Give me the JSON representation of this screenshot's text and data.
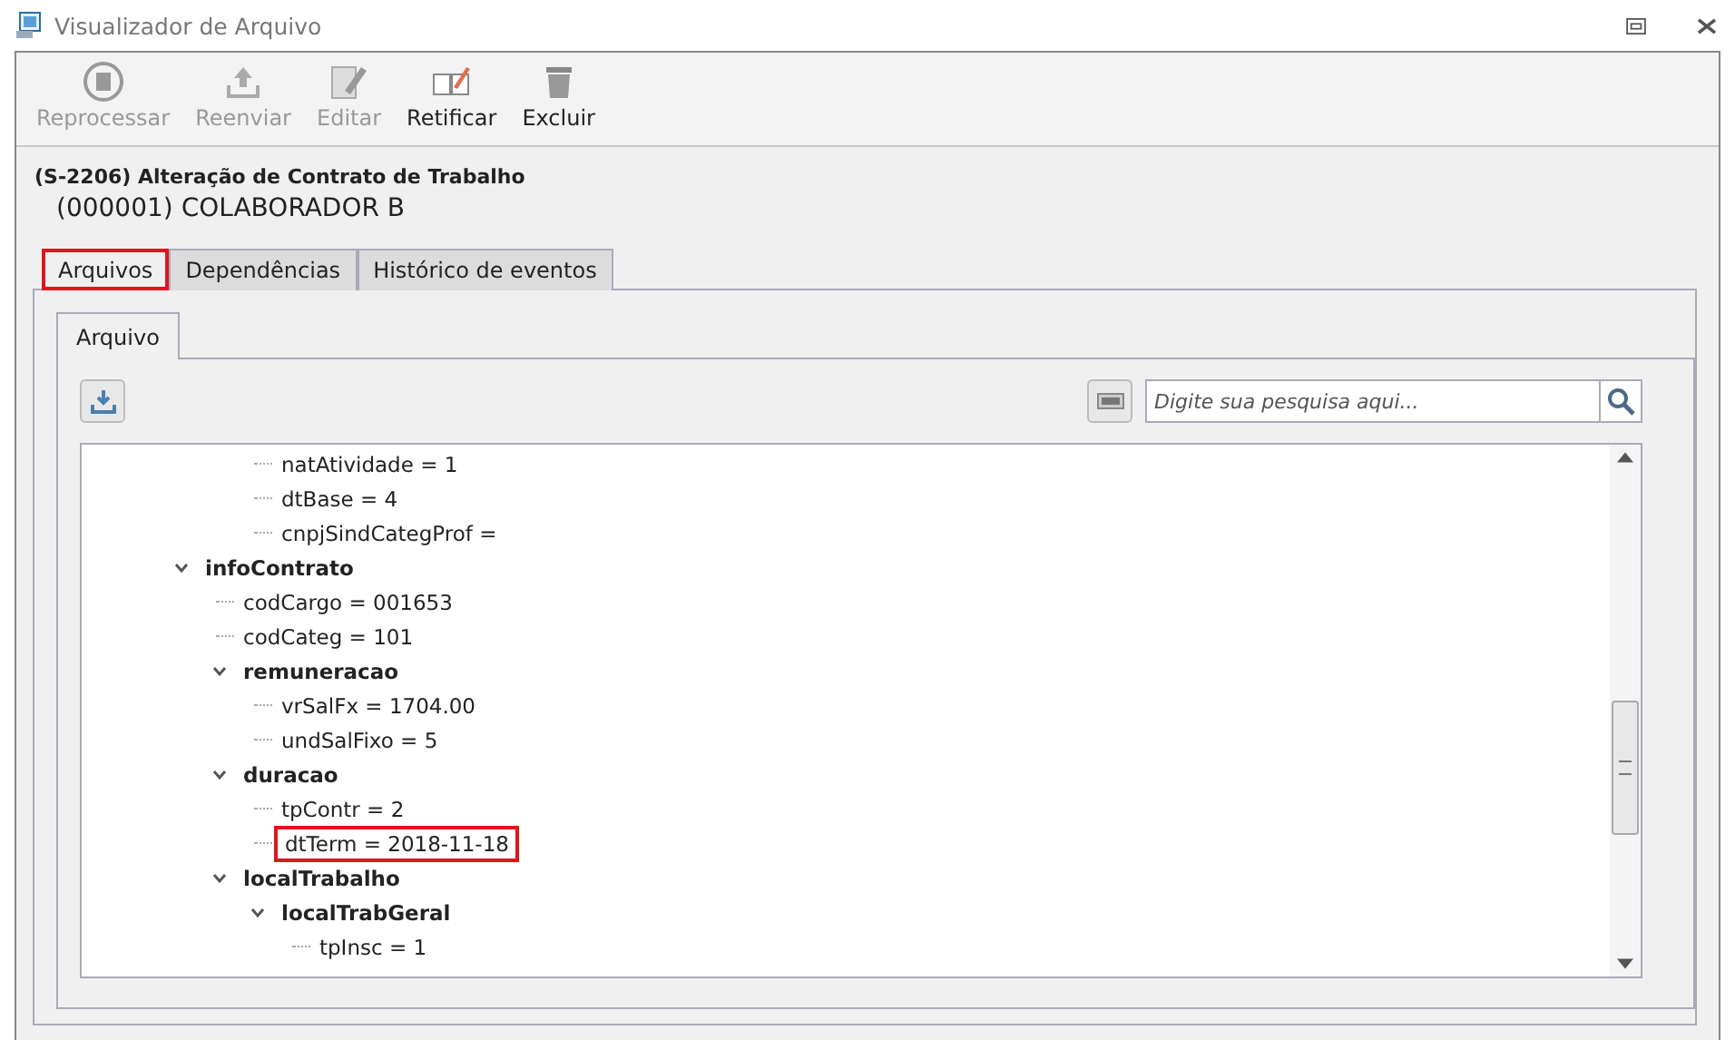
{
  "window": {
    "title": "Visualizador de Arquivo"
  },
  "toolbar": [
    {
      "label": "Reprocessar",
      "kind": "reprocess",
      "disabled": true
    },
    {
      "label": "Reenviar",
      "kind": "upload",
      "disabled": true
    },
    {
      "label": "Editar",
      "kind": "edit",
      "disabled": true
    },
    {
      "label": "Retificar",
      "kind": "rectify",
      "disabled": false
    },
    {
      "label": "Excluir",
      "kind": "delete",
      "disabled": false
    }
  ],
  "header": {
    "event": "(S-2206) Alteração de Contrato de Trabalho",
    "employee": "(000001) COLABORADOR B"
  },
  "tabs": [
    {
      "label": "Arquivos",
      "selected": true,
      "highlighted": true
    },
    {
      "label": "Dependências",
      "selected": false,
      "highlighted": false
    },
    {
      "label": "Histórico de eventos",
      "selected": false,
      "highlighted": false
    }
  ],
  "inner_tabs": [
    {
      "label": "Arquivo",
      "selected": true
    }
  ],
  "search": {
    "placeholder": "Digite sua pesquisa aqui..."
  },
  "tree": [
    {
      "children": [
        {
          "children": [
            {
              "label": "natAtividade = 1",
              "highlighted": false
            },
            {
              "label": "dtBase = 4",
              "highlighted": false
            },
            {
              "label": "cnpjSindCategProf =",
              "highlighted": false
            }
          ]
        }
      ]
    },
    {
      "label": "infoContrato",
      "expanded": true,
      "highlighted": false,
      "children": [
        {
          "label": "codCargo = 001653",
          "highlighted": false
        },
        {
          "label": "codCateg = 101",
          "highlighted": false
        },
        {
          "label": "remuneracao",
          "expanded": true,
          "highlighted": false,
          "children": [
            {
              "label": "vrSalFx = 1704.00",
              "highlighted": false
            },
            {
              "label": "undSalFixo = 5",
              "highlighted": false
            }
          ]
        },
        {
          "label": "duracao",
          "expanded": true,
          "highlighted": false,
          "children": [
            {
              "label": "tpContr = 2",
              "highlighted": false
            },
            {
              "label": "dtTerm = 2018-11-18",
              "highlighted": true
            }
          ]
        },
        {
          "label": "localTrabalho",
          "expanded": true,
          "highlighted": false,
          "children": [
            {
              "label": "localTrabGeral",
              "expanded": true,
              "highlighted": false,
              "children": [
                {
                  "label": "tpInsc = 1",
                  "highlighted": false
                }
              ]
            }
          ]
        }
      ]
    }
  ]
}
